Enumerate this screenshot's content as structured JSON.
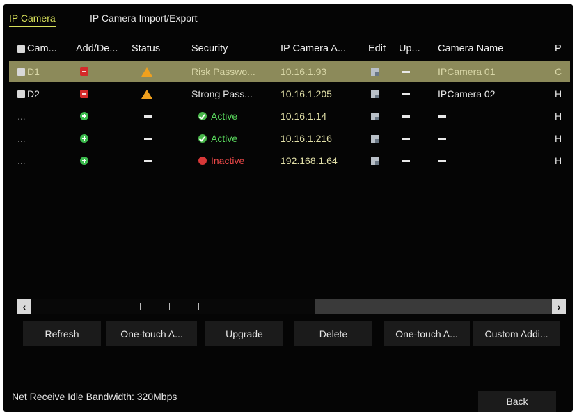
{
  "tabs": [
    {
      "label": "IP Camera",
      "active": true
    },
    {
      "label": "IP Camera Import/Export",
      "active": false
    }
  ],
  "table": {
    "headers": {
      "camera": "Cam...",
      "add_delete": "Add/De...",
      "status": "Status",
      "security": "Security",
      "ip": "IP Camera A...",
      "edit": "Edit",
      "upgrade": "Up...",
      "name": "Camera Name",
      "protocol": "P"
    },
    "rows": [
      {
        "camera": "D1",
        "security": "Risk Passwo...",
        "ip": "10.16.1.93",
        "name": "IPCamera 01",
        "protocol": "C"
      },
      {
        "camera": "D2",
        "security": "Strong Pass...",
        "ip": "10.16.1.205",
        "name": "IPCamera 02",
        "protocol": "H"
      },
      {
        "camera": "...",
        "security": "Active",
        "ip": "10.16.1.14",
        "protocol": "H"
      },
      {
        "camera": "...",
        "security": "Active",
        "ip": "10.16.1.216",
        "protocol": "H"
      },
      {
        "camera": "...",
        "security": "Inactive",
        "ip": "192.168.1.64",
        "protocol": "H"
      }
    ]
  },
  "buttons": {
    "refresh": "Refresh",
    "one_touch_1": "One-touch A...",
    "upgrade": "Upgrade",
    "delete": "Delete",
    "one_touch_2": "One-touch A...",
    "custom_add": "Custom Addi...",
    "back": "Back"
  },
  "bandwidth": "Net Receive Idle Bandwidth: 320Mbps",
  "colors": {
    "accent": "#d7e05a",
    "selected_row": "#8c8a5a",
    "active": "#58d55c",
    "inactive": "#ec4848",
    "warning": "#f0a01e",
    "delete": "#d42a2a",
    "add": "#3cbc4e"
  }
}
